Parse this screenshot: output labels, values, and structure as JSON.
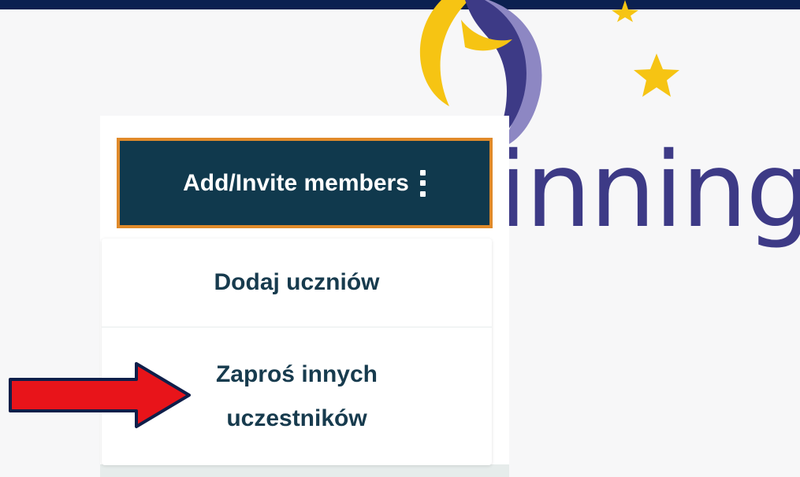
{
  "background": {
    "logo_wordmark": "inning",
    "colors": {
      "top_bar": "#0b2050",
      "logo_purple": "#3d3a86",
      "logo_yellow": "#f6c413"
    }
  },
  "toolbar": {
    "add_invite_label": "Add/Invite members",
    "kebab_icon": "more-vertical-icon",
    "button_bg": "#10394d",
    "button_border": "#e08a2a"
  },
  "menu": {
    "items": [
      {
        "label": "Dodaj uczniów"
      },
      {
        "label": "Zaproś innych uczestników"
      }
    ]
  },
  "annotation": {
    "arrow_icon": "red-arrow-icon",
    "arrow_color": "#e8141a"
  }
}
